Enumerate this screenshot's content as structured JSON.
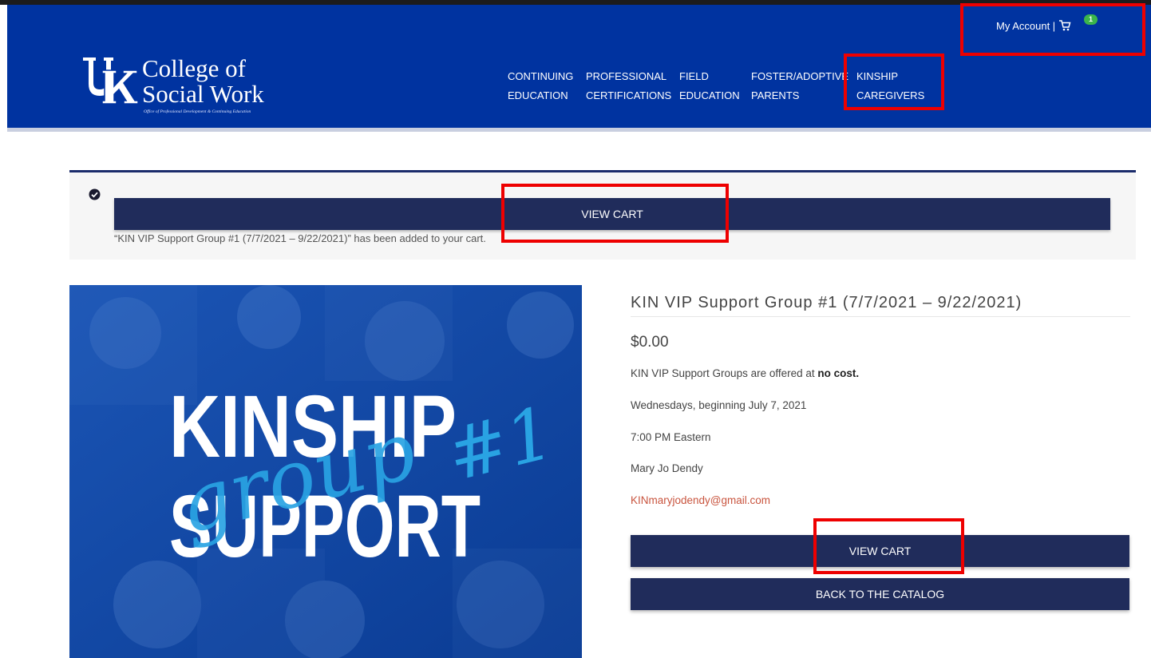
{
  "header": {
    "logo": {
      "line1": "College of",
      "line2": "Social Work",
      "tagline": "Office of Professional Development & Continuing Education",
      "icon": "uk-logo"
    },
    "nav": [
      {
        "line1": "CONTINUING",
        "line2": "EDUCATION"
      },
      {
        "line1": "PROFESSIONAL",
        "line2": "CERTIFICATIONS"
      },
      {
        "line1": "FIELD",
        "line2": "EDUCATION"
      },
      {
        "line1": "FOSTER/ADOPTIVE",
        "line2": "PARENTS"
      },
      {
        "line1": "KINSHIP",
        "line2": "CAREGIVERS"
      }
    ],
    "account": {
      "label": "My Account |",
      "cart_icon": "cart-icon",
      "cart_count": "1"
    }
  },
  "notice": {
    "icon": "check-circle-icon",
    "button_label": "VIEW CART",
    "message": "“KIN VIP Support Group #1 (7/7/2021 – 9/22/2021)” has been added to your cart."
  },
  "product": {
    "image_text": {
      "word1": "KINSHIP",
      "word2": "group",
      "word3": "#1",
      "word4": "SUPPORT"
    },
    "title": "KIN VIP Support Group #1 (7/7/2021 – 9/22/2021)",
    "price": "$0.00",
    "cost_text": "KIN VIP Support Groups are offered at",
    "cost_bold": "no cost.",
    "schedule": "Wednesdays, beginning July 7, 2021",
    "time": "7:00 PM Eastern",
    "facilitator": "Mary Jo Dendy",
    "email": "KINmaryjodendy@gmail.com",
    "view_cart_label": "VIEW CART",
    "back_label": "BACK TO THE CATALOG"
  },
  "colors": {
    "header_blue": "#0033a0",
    "button_navy": "#202c5b",
    "annotation_red": "#ee0000",
    "badge_green": "#3bb54a"
  }
}
